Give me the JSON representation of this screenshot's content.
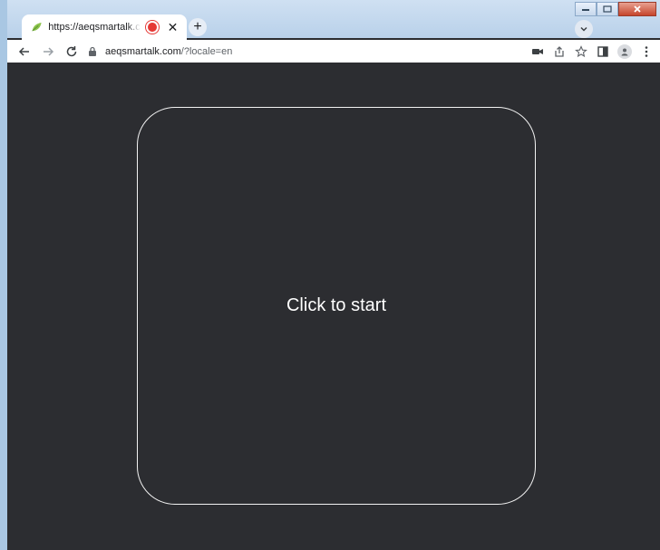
{
  "browser": {
    "tab": {
      "title": "https://aeqsmartalk.com/?locale=en",
      "favicon": "leaf-icon",
      "recording": true
    },
    "address": {
      "domain": "aeqsmartalk.com",
      "path": "/?locale=en"
    }
  },
  "page": {
    "start_label": "Click to start",
    "background": "#2c2d31",
    "card_border": "#f2f2f2"
  }
}
